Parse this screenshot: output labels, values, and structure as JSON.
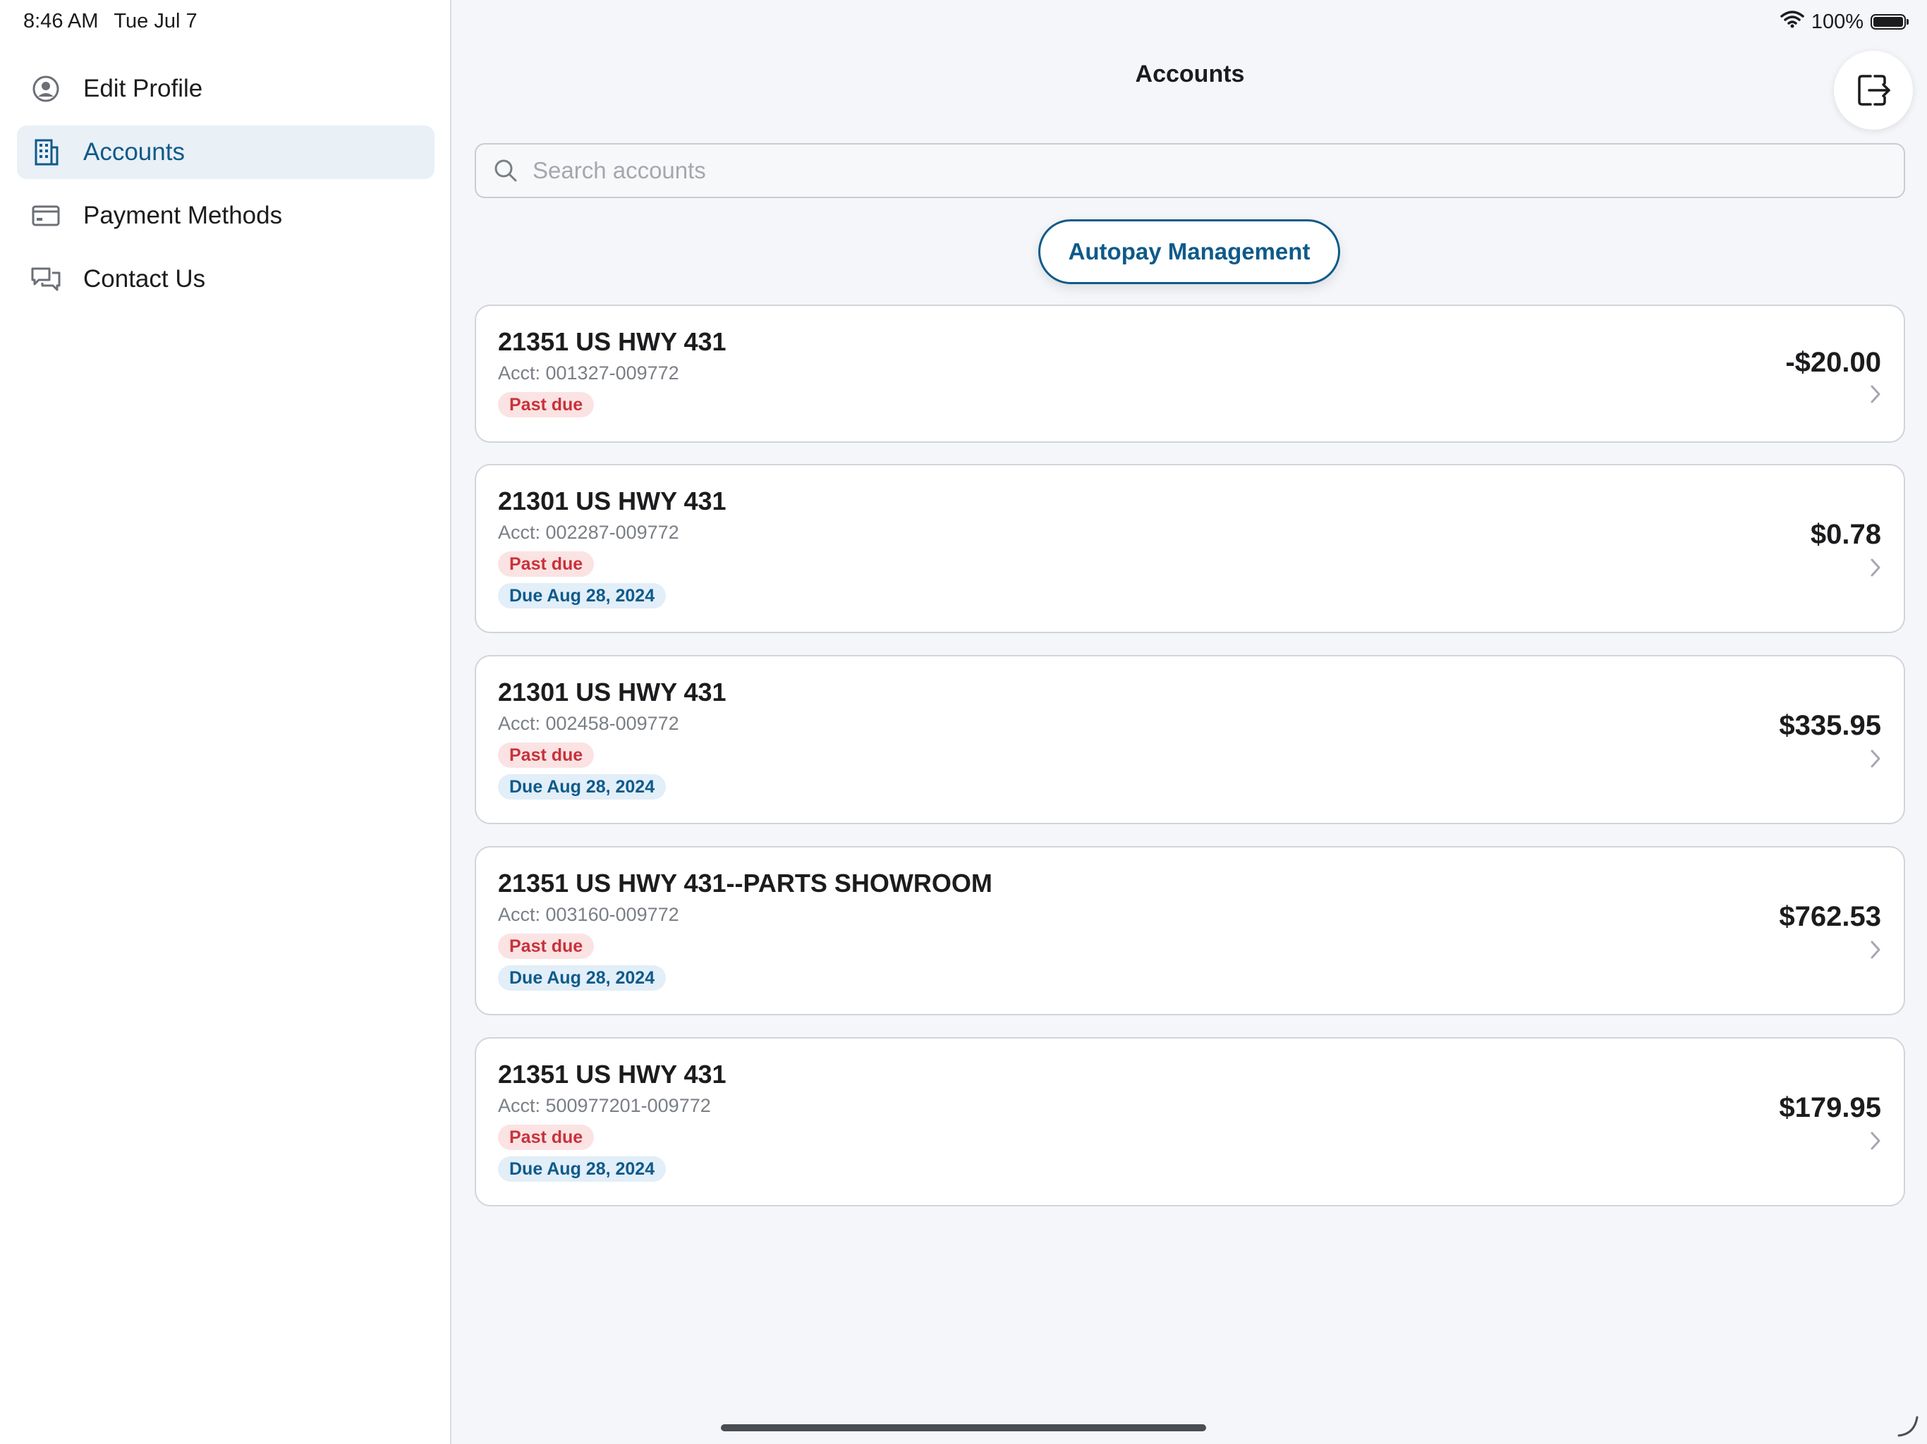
{
  "status_bar": {
    "time": "8:46 AM",
    "date": "Tue Jul 7",
    "battery": "100%"
  },
  "sidebar": {
    "items": [
      {
        "label": "Edit Profile",
        "icon": "person-circle-icon"
      },
      {
        "label": "Accounts",
        "icon": "building-icon",
        "active": true
      },
      {
        "label": "Payment Methods",
        "icon": "credit-card-icon"
      },
      {
        "label": "Contact Us",
        "icon": "chat-bubbles-icon"
      }
    ]
  },
  "main": {
    "title": "Accounts",
    "search_placeholder": "Search accounts",
    "autopay_label": "Autopay Management",
    "accounts": [
      {
        "name": "21351 US HWY 431",
        "acct": "Acct: 001327-009772",
        "past_due": "Past due",
        "due": "",
        "amount": "-$20.00"
      },
      {
        "name": "21301 US HWY 431",
        "acct": "Acct: 002287-009772",
        "past_due": "Past due",
        "due": "Due Aug 28, 2024",
        "amount": "$0.78"
      },
      {
        "name": "21301 US HWY 431",
        "acct": "Acct: 002458-009772",
        "past_due": "Past due",
        "due": "Due Aug 28, 2024",
        "amount": "$335.95"
      },
      {
        "name": "21351 US HWY 431--PARTS SHOWROOM",
        "acct": "Acct: 003160-009772",
        "past_due": "Past due",
        "due": "Due Aug 28, 2024",
        "amount": "$762.53"
      },
      {
        "name": "21351 US HWY 431",
        "acct": "Acct: 500977201-009772",
        "past_due": "Past due",
        "due": "Due Aug 28, 2024",
        "amount": "$179.95"
      }
    ]
  },
  "colors": {
    "accent": "#0e5a8a",
    "past_due_text": "#c8323b",
    "past_due_bg": "#fbe3e3",
    "due_bg": "#e2eef8"
  }
}
